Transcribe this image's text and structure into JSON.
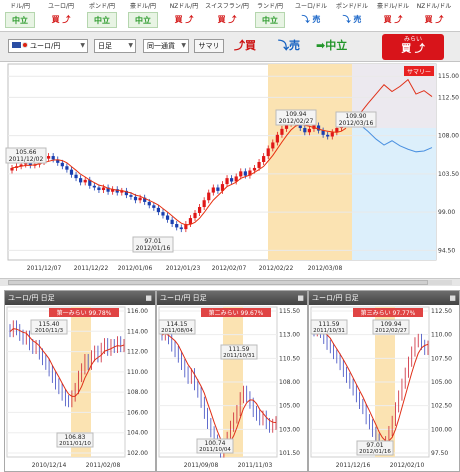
{
  "currency_strip": [
    {
      "name": "ドル/円",
      "signal": "中立",
      "kind": "neutral"
    },
    {
      "name": "ユーロ/円",
      "signal": "買",
      "kind": "buy"
    },
    {
      "name": "ポンド/円",
      "signal": "中立",
      "kind": "neutral"
    },
    {
      "name": "豪ドル/円",
      "signal": "中立",
      "kind": "neutral"
    },
    {
      "name": "NZドル/円",
      "signal": "買",
      "kind": "buy"
    },
    {
      "name": "スイスフラン/円",
      "signal": "買",
      "kind": "buy"
    },
    {
      "name": "ランド/円",
      "signal": "中立",
      "kind": "neutral"
    },
    {
      "name": "ユーロ/ドル",
      "signal": "売",
      "kind": "sell"
    },
    {
      "name": "ポンド/ドル",
      "signal": "売",
      "kind": "sell"
    },
    {
      "name": "豪ドル/ドル",
      "signal": "買",
      "kind": "buy"
    },
    {
      "name": "NZドル/ドル",
      "signal": "買",
      "kind": "buy"
    }
  ],
  "toolbar": {
    "pair_select": "ユーロ/円",
    "period_select": "日足",
    "series_select": "同一通貨",
    "summary_button": "サマリ",
    "buy_label": "買",
    "sell_label": "売",
    "neutral_label": "中立",
    "mirai_top": "みらい",
    "mirai_main": "買"
  },
  "main_chart": {
    "y_ticks": [
      "115.00",
      "112.50",
      "108.00",
      "103.50",
      "99.00",
      "94.50"
    ],
    "x_ticks": [
      "2011/12/07",
      "2011/12/22",
      "2012/01/06",
      "2012/01/23",
      "2012/02/07",
      "2012/02/22",
      "2012/03/08"
    ],
    "summary_label": "サマリー",
    "annotations": [
      {
        "value": "105.66",
        "date": "2011/12/02"
      },
      {
        "value": "97.01",
        "date": "2012/01/16"
      },
      {
        "value": "109.94",
        "date": "2012/02/27"
      },
      {
        "value": "109.90",
        "date": "2012/03/16"
      }
    ],
    "colors": {
      "up": "#e01818",
      "down": "#1a3fb0",
      "ma": "#e83010",
      "highlight": "#fbe3b2",
      "forecast": "#dceffb"
    }
  },
  "panels": [
    {
      "title": "ユーロ/円 日足",
      "badge": "第一みらい 99.78%",
      "y_ticks": [
        "116.00",
        "114.00",
        "112.00",
        "110.00",
        "108.00",
        "106.00",
        "104.00",
        "102.00"
      ],
      "x_ticks": [
        "2010/12/14",
        "2011/02/08"
      ],
      "annotations": [
        {
          "value": "115.40",
          "date": "2010/11/3"
        },
        {
          "value": "106.83",
          "date": "2011/01/10"
        }
      ]
    },
    {
      "title": "ユーロ/円 日足",
      "badge": "第二みらい 99.67%",
      "y_ticks": [
        "115.50",
        "113.00",
        "110.50",
        "108.00",
        "105.00",
        "103.00",
        "101.50"
      ],
      "x_ticks": [
        "2011/09/08",
        "2011/11/03"
      ],
      "annotations": [
        {
          "value": "114.15",
          "date": "2011/08/04"
        },
        {
          "value": "111.59",
          "date": "2011/10/31"
        },
        {
          "value": "100.74",
          "date": "2011/10/04"
        }
      ]
    },
    {
      "title": "ユーロ/円 日足",
      "badge": "第三みらい 97.77%",
      "y_ticks": [
        "112.50",
        "110.00",
        "107.50",
        "105.00",
        "102.50",
        "100.00",
        "97.50"
      ],
      "x_ticks": [
        "2011/12/16",
        "2012/02/10"
      ],
      "annotations": [
        {
          "value": "111.59",
          "date": "2011/10/31"
        },
        {
          "value": "109.94",
          "date": "2012/02/27"
        },
        {
          "value": "97.01",
          "date": "2012/01/16"
        }
      ]
    }
  ]
}
